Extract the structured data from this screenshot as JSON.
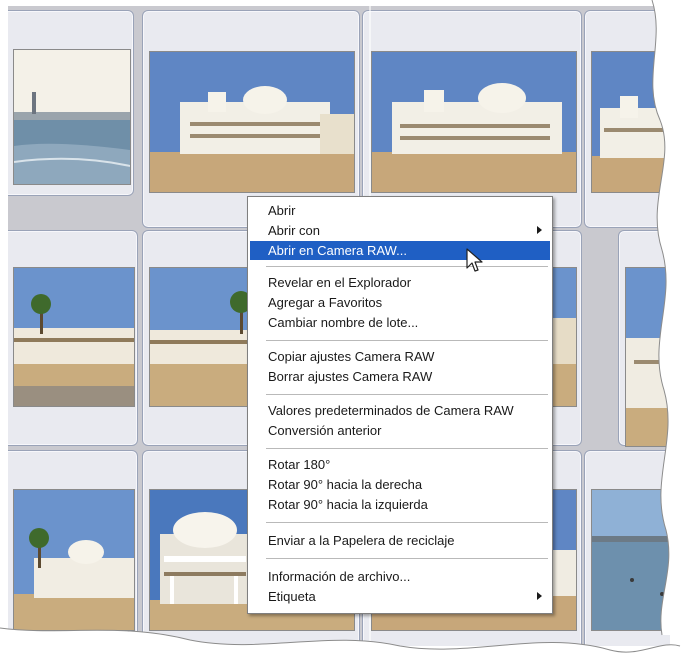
{
  "context_menu": {
    "items": [
      {
        "label": "Abrir"
      },
      {
        "label": "Abrir con"
      },
      {
        "label": "Abrir en Camera RAW..."
      },
      {
        "label": "Revelar en el Explorador"
      },
      {
        "label": "Agregar a Favoritos"
      },
      {
        "label": "Cambiar nombre de lote..."
      },
      {
        "label": "Copiar ajustes Camera RAW"
      },
      {
        "label": "Borrar ajustes Camera RAW"
      },
      {
        "label": "Valores predeterminados de Camera RAW"
      },
      {
        "label": "Conversión anterior"
      },
      {
        "label": "Rotar 180°"
      },
      {
        "label": "Rotar 90° hacia la derecha"
      },
      {
        "label": "Rotar 90° hacia la izquierda"
      },
      {
        "label": "Enviar a la Papelera de reciclaje"
      },
      {
        "label": "Información de archivo..."
      },
      {
        "label": "Etiqueta"
      }
    ],
    "highlighted_item": "Abrir en Camera RAW...",
    "submenu_items": [
      "Abrir con",
      "Etiqueta"
    ]
  },
  "thumbnails": [
    {
      "subject": "seafront-lighthouse"
    },
    {
      "subject": "white-pavilion-beach"
    },
    {
      "subject": "white-pavilion-beach"
    },
    {
      "subject": "white-pavilion-beach"
    },
    {
      "subject": "promenade-palms"
    },
    {
      "subject": "promenade-palms"
    },
    {
      "subject": "promenade-palms"
    },
    {
      "subject": "pavilion-side"
    },
    {
      "subject": "beach-pavilion-palms"
    },
    {
      "subject": "white-pavilion-closeup"
    },
    {
      "subject": "white-pavilion-beach"
    },
    {
      "subject": "sea-swimmers"
    }
  ],
  "colors": {
    "menu_highlight": "#1f5fc4",
    "grid_background": "#c9c9cf",
    "cell_background": "#e9eaf0"
  }
}
